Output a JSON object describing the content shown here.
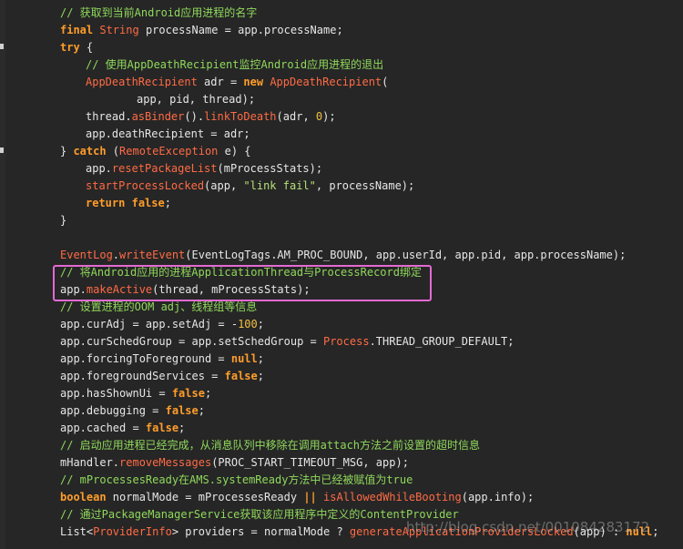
{
  "editor": {
    "lines": [
      {
        "indent": 8,
        "tokens": [
          {
            "t": "// 获取到当前Android应用进程的名字",
            "c": "comment"
          }
        ]
      },
      {
        "indent": 8,
        "tokens": [
          {
            "t": "final",
            "c": "keyword"
          },
          {
            "t": " ",
            "c": "plain"
          },
          {
            "t": "String",
            "c": "type"
          },
          {
            "t": " processName = app.processName;",
            "c": "plain"
          }
        ]
      },
      {
        "indent": 8,
        "tokens": [
          {
            "t": "try",
            "c": "keyword"
          },
          {
            "t": " {",
            "c": "plain"
          }
        ]
      },
      {
        "indent": 12,
        "tokens": [
          {
            "t": "// 使用AppDeathRecipient监控Android应用进程的退出",
            "c": "comment"
          }
        ]
      },
      {
        "indent": 12,
        "tokens": [
          {
            "t": "AppDeathRecipient",
            "c": "type"
          },
          {
            "t": " adr = ",
            "c": "plain"
          },
          {
            "t": "new",
            "c": "keyword"
          },
          {
            "t": " ",
            "c": "plain"
          },
          {
            "t": "AppDeathRecipient",
            "c": "type"
          },
          {
            "t": "(",
            "c": "plain"
          }
        ]
      },
      {
        "indent": 20,
        "tokens": [
          {
            "t": "app, pid, thread);",
            "c": "plain"
          }
        ]
      },
      {
        "indent": 12,
        "tokens": [
          {
            "t": "thread.",
            "c": "plain"
          },
          {
            "t": "asBinder",
            "c": "method"
          },
          {
            "t": "().",
            "c": "plain"
          },
          {
            "t": "linkToDeath",
            "c": "method"
          },
          {
            "t": "(adr, ",
            "c": "plain"
          },
          {
            "t": "0",
            "c": "number"
          },
          {
            "t": ");",
            "c": "plain"
          }
        ]
      },
      {
        "indent": 12,
        "tokens": [
          {
            "t": "app.deathRecipient = adr;",
            "c": "plain"
          }
        ]
      },
      {
        "indent": 8,
        "tokens": [
          {
            "t": "} ",
            "c": "plain"
          },
          {
            "t": "catch",
            "c": "keyword"
          },
          {
            "t": " (",
            "c": "plain"
          },
          {
            "t": "RemoteException",
            "c": "type"
          },
          {
            "t": " e) {",
            "c": "plain"
          }
        ]
      },
      {
        "indent": 12,
        "tokens": [
          {
            "t": "app.",
            "c": "plain"
          },
          {
            "t": "resetPackageList",
            "c": "method"
          },
          {
            "t": "(mProcessStats);",
            "c": "plain"
          }
        ]
      },
      {
        "indent": 12,
        "tokens": [
          {
            "t": "startProcessLocked",
            "c": "method"
          },
          {
            "t": "(app, ",
            "c": "plain"
          },
          {
            "t": "\"link fail\"",
            "c": "string"
          },
          {
            "t": ", processName);",
            "c": "plain"
          }
        ]
      },
      {
        "indent": 12,
        "tokens": [
          {
            "t": "return",
            "c": "keyword"
          },
          {
            "t": " ",
            "c": "plain"
          },
          {
            "t": "false",
            "c": "keyword"
          },
          {
            "t": ";",
            "c": "plain"
          }
        ]
      },
      {
        "indent": 8,
        "tokens": [
          {
            "t": "}",
            "c": "plain"
          }
        ]
      },
      {
        "indent": 0,
        "tokens": []
      },
      {
        "indent": 8,
        "tokens": [
          {
            "t": "EventLog",
            "c": "type"
          },
          {
            "t": ".",
            "c": "plain"
          },
          {
            "t": "writeEvent",
            "c": "method"
          },
          {
            "t": "(EventLogTags.AM_PROC_BOUND, app.userId, app.pid, app.processName);",
            "c": "plain"
          }
        ]
      },
      {
        "indent": 8,
        "tokens": [
          {
            "t": "// 将Android应用的进程ApplicationThread与ProcessRecord绑定",
            "c": "comment"
          }
        ]
      },
      {
        "indent": 8,
        "tokens": [
          {
            "t": "app.",
            "c": "plain"
          },
          {
            "t": "makeActive",
            "c": "method"
          },
          {
            "t": "(thread, mProcessStats);",
            "c": "plain"
          }
        ]
      },
      {
        "indent": 8,
        "tokens": [
          {
            "t": "// 设置进程的OOM adj、线程组等信息",
            "c": "comment"
          }
        ]
      },
      {
        "indent": 8,
        "tokens": [
          {
            "t": "app.curAdj = app.setAdj = -",
            "c": "plain"
          },
          {
            "t": "100",
            "c": "number"
          },
          {
            "t": ";",
            "c": "plain"
          }
        ]
      },
      {
        "indent": 8,
        "tokens": [
          {
            "t": "app.curSchedGroup = app.setSchedGroup = ",
            "c": "plain"
          },
          {
            "t": "Process",
            "c": "type"
          },
          {
            "t": ".THREAD_GROUP_DEFAULT;",
            "c": "plain"
          }
        ]
      },
      {
        "indent": 8,
        "tokens": [
          {
            "t": "app.forcingToForeground = ",
            "c": "plain"
          },
          {
            "t": "null",
            "c": "keyword"
          },
          {
            "t": ";",
            "c": "plain"
          }
        ]
      },
      {
        "indent": 8,
        "tokens": [
          {
            "t": "app.foregroundServices = ",
            "c": "plain"
          },
          {
            "t": "false",
            "c": "keyword"
          },
          {
            "t": ";",
            "c": "plain"
          }
        ]
      },
      {
        "indent": 8,
        "tokens": [
          {
            "t": "app.hasShownUi = ",
            "c": "plain"
          },
          {
            "t": "false",
            "c": "keyword"
          },
          {
            "t": ";",
            "c": "plain"
          }
        ]
      },
      {
        "indent": 8,
        "tokens": [
          {
            "t": "app.debugging = ",
            "c": "plain"
          },
          {
            "t": "false",
            "c": "keyword"
          },
          {
            "t": ";",
            "c": "plain"
          }
        ]
      },
      {
        "indent": 8,
        "tokens": [
          {
            "t": "app.cached = ",
            "c": "plain"
          },
          {
            "t": "false",
            "c": "keyword"
          },
          {
            "t": ";",
            "c": "plain"
          }
        ]
      },
      {
        "indent": 8,
        "tokens": [
          {
            "t": "// 启动应用进程已经完成，从消息队列中移除在调用attach方法之前设置的超时信息",
            "c": "comment"
          }
        ]
      },
      {
        "indent": 8,
        "tokens": [
          {
            "t": "mHandler.",
            "c": "plain"
          },
          {
            "t": "removeMessages",
            "c": "method"
          },
          {
            "t": "(PROC_START_TIMEOUT_MSG, app);",
            "c": "plain"
          }
        ]
      },
      {
        "indent": 8,
        "tokens": [
          {
            "t": "// mProcessesReady在AMS.systemReady方法中已经被赋值为true",
            "c": "comment"
          }
        ]
      },
      {
        "indent": 8,
        "tokens": [
          {
            "t": "boolean",
            "c": "keyword"
          },
          {
            "t": " normalMode = mProcessesReady ",
            "c": "plain"
          },
          {
            "t": "||",
            "c": "keyword"
          },
          {
            "t": " ",
            "c": "plain"
          },
          {
            "t": "isAllowedWhileBooting",
            "c": "method"
          },
          {
            "t": "(app.info);",
            "c": "plain"
          }
        ]
      },
      {
        "indent": 8,
        "tokens": [
          {
            "t": "// 通过PackageManagerService获取该应用程序中定义的ContentProvider",
            "c": "comment"
          }
        ]
      },
      {
        "indent": 8,
        "tokens": [
          {
            "t": "List<",
            "c": "plain"
          },
          {
            "t": "ProviderInfo",
            "c": "type"
          },
          {
            "t": "> providers = normalMode ? ",
            "c": "plain"
          },
          {
            "t": "generateApplicationProvidersLocked",
            "c": "method"
          },
          {
            "t": "(app) : ",
            "c": "plain"
          },
          {
            "t": "null",
            "c": "keyword"
          },
          {
            "t": ";",
            "c": "plain"
          }
        ]
      }
    ]
  },
  "watermark": "http://blog.csdn.net/001084283172",
  "colors": {
    "background": "#262626",
    "comment": "#8fd85b",
    "keyword": "#ff9d2b",
    "type": "#ff6b45",
    "number": "#f0c040",
    "string": "#b6e07a",
    "highlight_border": "#e26bd3"
  }
}
